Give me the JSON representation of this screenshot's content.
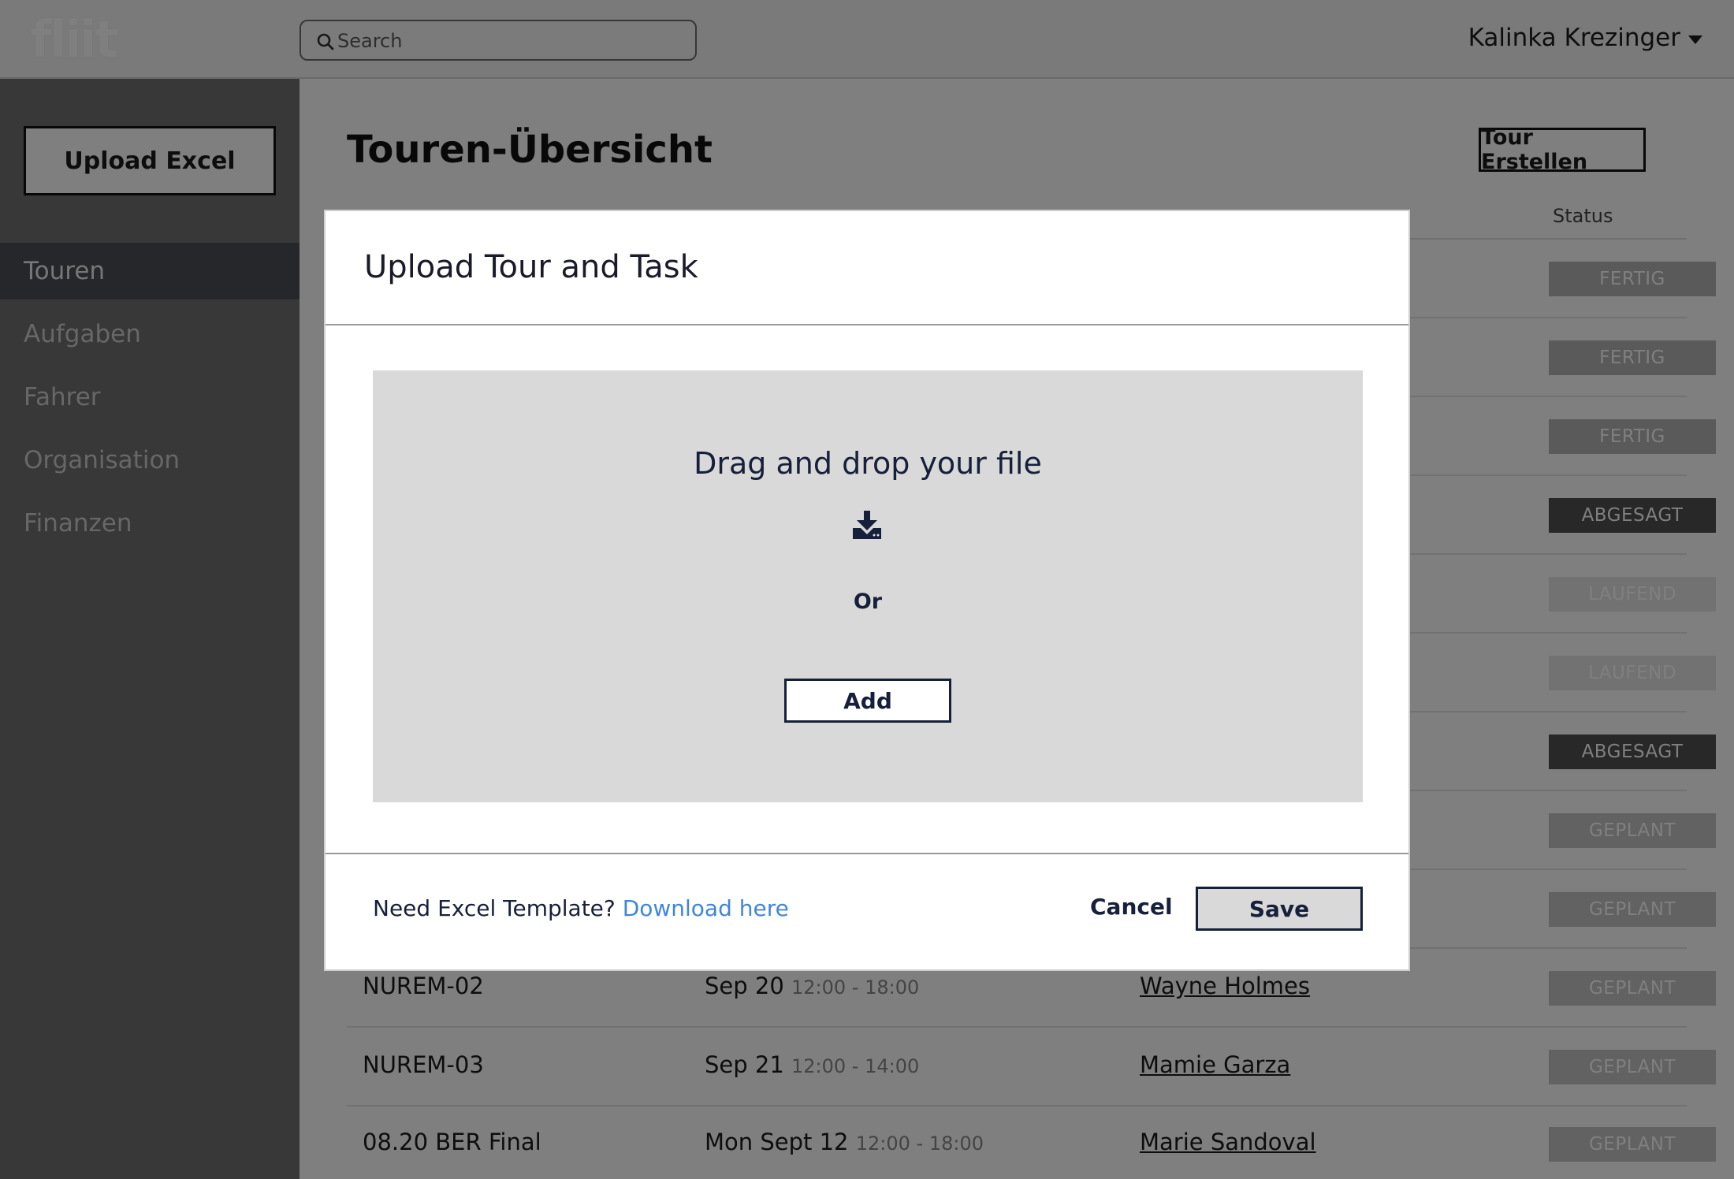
{
  "app": {
    "logo_text": "fliit"
  },
  "search": {
    "placeholder": "Search"
  },
  "user": {
    "name": "Kalinka Krezinger"
  },
  "sidebar": {
    "upload_label": "Upload Excel",
    "items": [
      {
        "label": "Touren",
        "active": true
      },
      {
        "label": "Aufgaben",
        "active": false
      },
      {
        "label": "Fahrer",
        "active": false
      },
      {
        "label": "Organisation",
        "active": false
      },
      {
        "label": "Finanzen",
        "active": false
      }
    ]
  },
  "page": {
    "title": "Touren-Übersicht",
    "create_label": "Tour Erstellen"
  },
  "table": {
    "status_header": "Status",
    "rows": [
      {
        "name": "",
        "date": "",
        "time": "",
        "driver": "",
        "status": "FERTIG"
      },
      {
        "name": "",
        "date": "",
        "time": "",
        "driver": "",
        "status": "FERTIG"
      },
      {
        "name": "",
        "date": "",
        "time": "",
        "driver": "",
        "status": "FERTIG"
      },
      {
        "name": "",
        "date": "",
        "time": "",
        "driver": "",
        "status": "ABGESAGT"
      },
      {
        "name": "",
        "date": "",
        "time": "",
        "driver": "",
        "status": "LAUFEND"
      },
      {
        "name": "",
        "date": "",
        "time": "",
        "driver": "",
        "status": "LAUFEND"
      },
      {
        "name": "",
        "date": "",
        "time": "",
        "driver": "",
        "status": "ABGESAGT"
      },
      {
        "name": "",
        "date": "",
        "time": "",
        "driver": "",
        "status": "GEPLANT"
      },
      {
        "name": "",
        "date": "",
        "time": "",
        "driver": "",
        "status": "GEPLANT"
      },
      {
        "name": "NUREM-02",
        "date": "Sep 20",
        "time": "12:00 - 18:00",
        "driver": "Wayne Holmes",
        "status": "GEPLANT"
      },
      {
        "name": "NUREM-03",
        "date": "Sep 21",
        "time": "12:00 - 14:00",
        "driver": "Mamie Garza",
        "status": "GEPLANT"
      },
      {
        "name": "08.20 BER Final",
        "date": "Mon Sept 12",
        "time": "12:00 - 18:00",
        "driver": "Marie Sandoval",
        "status": "GEPLANT"
      }
    ]
  },
  "status_colors": {
    "FERTIG": "#b4b4b4",
    "ABGESAGT": "#505050",
    "LAUFEND": "#e4e4e4",
    "GEPLANT": "#c4c4c4"
  },
  "modal": {
    "title": "Upload Tour and Task",
    "drop_text": "Drag and drop your file",
    "drop_icon": "download-icon",
    "or_text": "Or",
    "add_label": "Add",
    "template_text": "Need Excel Template?",
    "template_link": "Download here",
    "cancel_label": "Cancel",
    "save_label": "Save"
  }
}
